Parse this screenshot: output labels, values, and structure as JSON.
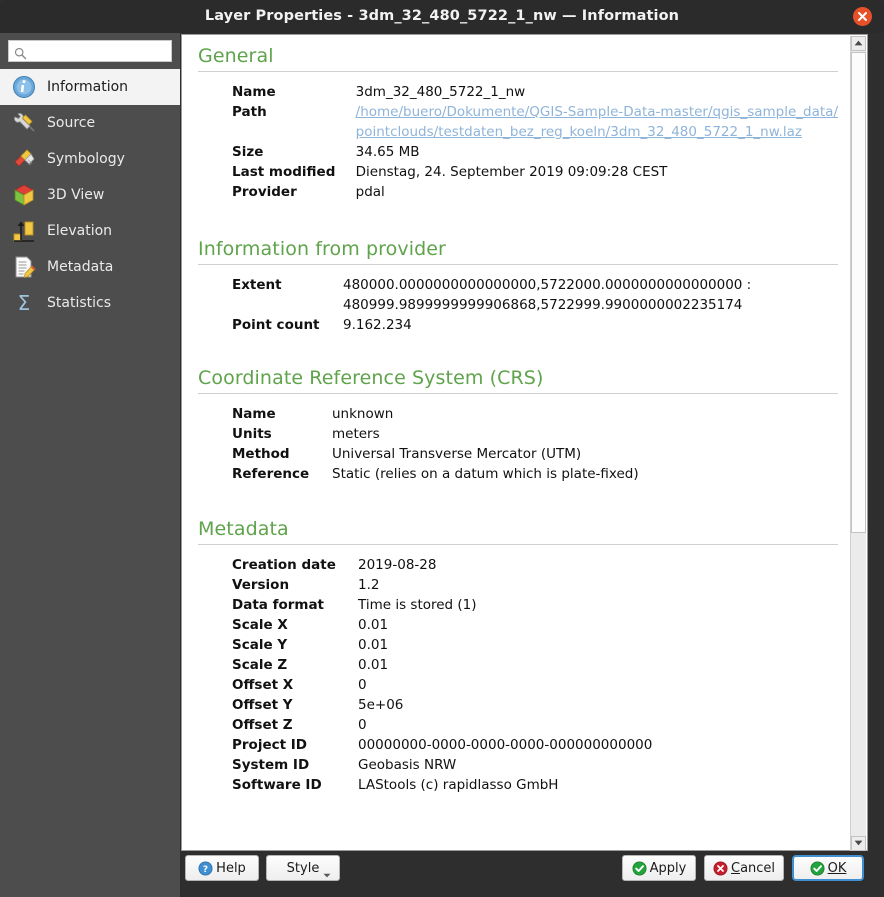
{
  "window": {
    "title": "Layer Properties - 3dm_32_480_5722_1_nw — Information",
    "close_icon": "close-icon"
  },
  "sidebar": {
    "search": {
      "value": "",
      "placeholder": "",
      "icon": "search-icon"
    },
    "items": [
      {
        "label": "Information",
        "icon": "information-icon",
        "selected": true
      },
      {
        "label": "Source",
        "icon": "source-icon",
        "selected": false
      },
      {
        "label": "Symbology",
        "icon": "symbology-icon",
        "selected": false
      },
      {
        "label": "3D View",
        "icon": "3d-view-icon",
        "selected": false
      },
      {
        "label": "Elevation",
        "icon": "elevation-icon",
        "selected": false
      },
      {
        "label": "Metadata",
        "icon": "metadata-icon",
        "selected": false
      },
      {
        "label": "Statistics",
        "icon": "statistics-icon",
        "selected": false
      }
    ]
  },
  "content": {
    "sections": {
      "general": {
        "title": "General",
        "rows": {
          "name": {
            "label": "Name",
            "value": "3dm_32_480_5722_1_nw"
          },
          "path": {
            "label": "Path",
            "value": "/home/buero/Dokumente/QGIS-Sample-Data-master/qgis_sample_data/\npointclouds/testdaten_bez_reg_koeln/3dm_32_480_5722_1_nw.laz"
          },
          "size": {
            "label": "Size",
            "value": "34.65 MB"
          },
          "last_modified": {
            "label": "Last modified",
            "value": "Dienstag, 24. September 2019 09:09:28 CEST"
          },
          "provider": {
            "label": "Provider",
            "value": "pdal"
          }
        }
      },
      "provider_info": {
        "title": "Information from provider",
        "rows": {
          "extent": {
            "label": "Extent",
            "value": "480000.0000000000000000,5722000.0000000000000000 :\n480999.9899999999906868,5722999.9900000002235174"
          },
          "point_count": {
            "label": "Point count",
            "value": "9.162.234"
          }
        }
      },
      "crs": {
        "title": "Coordinate Reference System (CRS)",
        "rows": {
          "name": {
            "label": "Name",
            "value": "unknown"
          },
          "units": {
            "label": "Units",
            "value": "meters"
          },
          "method": {
            "label": "Method",
            "value": "Universal Transverse Mercator (UTM)"
          },
          "reference": {
            "label": "Reference",
            "value": "Static (relies on a datum which is plate-fixed)"
          }
        }
      },
      "metadata": {
        "title": "Metadata",
        "rows": {
          "creation_date": {
            "label": "Creation date",
            "value": "2019-08-28"
          },
          "version": {
            "label": "Version",
            "value": "1.2"
          },
          "data_format": {
            "label": "Data format",
            "value": "Time is stored (1)"
          },
          "scale_x": {
            "label": "Scale X",
            "value": "0.01"
          },
          "scale_y": {
            "label": "Scale Y",
            "value": "0.01"
          },
          "scale_z": {
            "label": "Scale Z",
            "value": "0.01"
          },
          "offset_x": {
            "label": "Offset X",
            "value": "0"
          },
          "offset_y": {
            "label": "Offset Y",
            "value": "5e+06"
          },
          "offset_z": {
            "label": "Offset Z",
            "value": "0"
          },
          "project_id": {
            "label": "Project ID",
            "value": "00000000-0000-0000-0000-000000000000"
          },
          "system_id": {
            "label": "System ID",
            "value": "Geobasis NRW"
          },
          "software_id": {
            "label": "Software ID",
            "value": "LAStools (c) rapidlasso GmbH"
          }
        }
      }
    }
  },
  "scrollbar": {
    "up_icon": "scroll-up-arrow-icon",
    "down_icon": "scroll-down-arrow-icon",
    "thumb": "scrollbar-thumb"
  },
  "buttons": {
    "help": {
      "label": "Help",
      "icon": "help-icon"
    },
    "style": {
      "label": "Style",
      "icon": "chevron-down-icon"
    },
    "apply": {
      "label": "Apply",
      "icon": "check-circle-green-icon"
    },
    "cancel": {
      "label": "Cancel",
      "icon": "cancel-circle-red-icon"
    },
    "ok": {
      "label": "OK",
      "icon": "check-circle-green-icon"
    }
  },
  "colors": {
    "section_heading": "#5fa34b",
    "titlebar": "#2b2b2b",
    "sidebar": "#4d4d4d",
    "close_button": "#e8502a",
    "link": "#8fb4d9",
    "focus_border": "#3f8fd2"
  }
}
